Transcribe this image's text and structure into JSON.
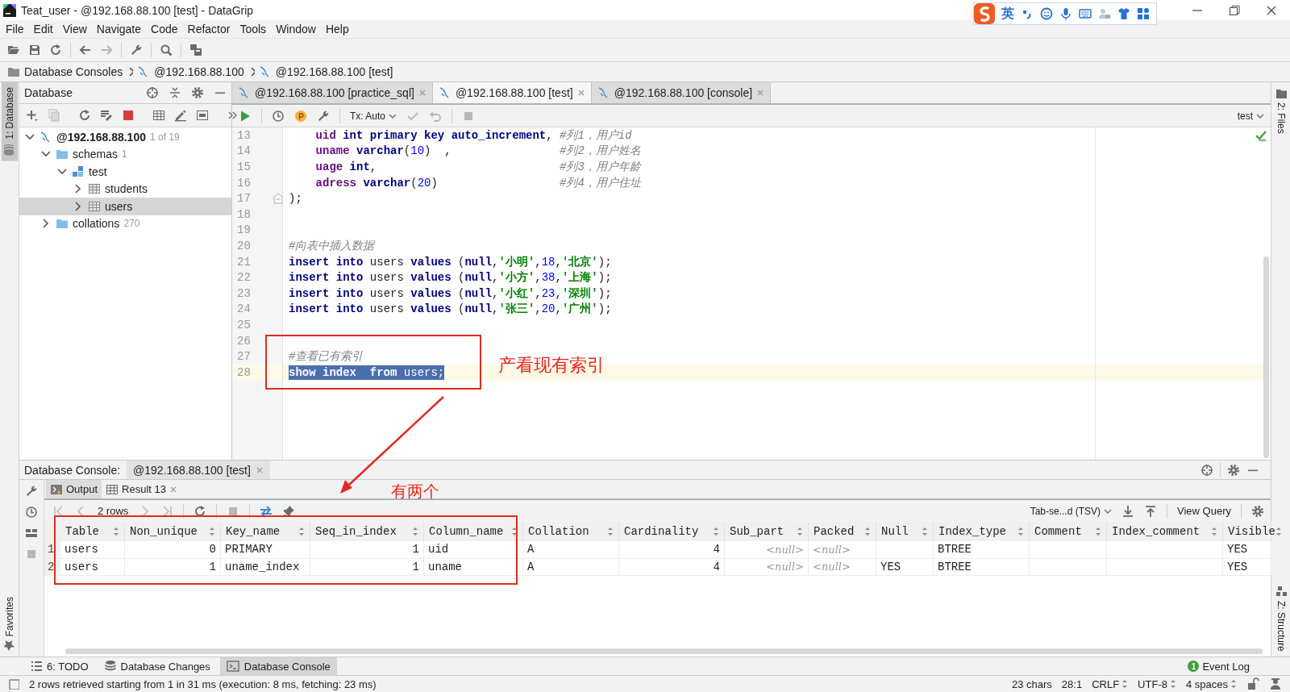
{
  "window": {
    "title": "Teat_user - @192.168.88.100 [test] - DataGrip"
  },
  "ime_toolbar": {
    "label": "英"
  },
  "menu": [
    "File",
    "Edit",
    "View",
    "Navigate",
    "Code",
    "Refactor",
    "Tools",
    "Window",
    "Help"
  ],
  "breadcrumbs": [
    "Database Consoles",
    "@192.168.88.100",
    "@192.168.88.100 [test]"
  ],
  "left_strip": {
    "top": "1: Database",
    "bottom": "Favorites"
  },
  "right_strip": {
    "top": "2: Files",
    "bottom": "Z: Structure"
  },
  "database_panel": {
    "title": "Database",
    "tree": [
      {
        "label": "@192.168.88.100",
        "badge": "1 of 19",
        "kind": "host",
        "expanded": true,
        "selected": false,
        "children": [
          {
            "label": "schemas",
            "badge": "1",
            "kind": "folder",
            "expanded": true,
            "selected": false,
            "children": [
              {
                "label": "test",
                "kind": "schema",
                "expanded": true,
                "selected": false,
                "children": [
                  {
                    "label": "students",
                    "kind": "table",
                    "expanded": false,
                    "selected": false
                  },
                  {
                    "label": "users",
                    "kind": "table",
                    "expanded": false,
                    "selected": true
                  }
                ]
              }
            ]
          },
          {
            "label": "collations",
            "badge": "270",
            "kind": "folder",
            "expanded": false,
            "selected": false
          }
        ]
      }
    ]
  },
  "editor": {
    "tabs": [
      {
        "label": "@192.168.88.100 [practice_sql]",
        "selected": false
      },
      {
        "label": "@192.168.88.100 [test]",
        "selected": true
      },
      {
        "label": "@192.168.88.100 [console]",
        "selected": false
      }
    ],
    "tx_mode": "Tx: Auto",
    "schema": "test",
    "lines": [
      {
        "no": "13",
        "current": false,
        "selected": false,
        "fold": false,
        "tokens": [
          {
            "kind": "col",
            "text": "    uid"
          },
          {
            "kind": "kw",
            "text": " int primary key auto_increment"
          },
          {
            "kind": "plain",
            "text": ","
          },
          {
            "kind": "trail",
            "text": "#列1，用户id"
          }
        ]
      },
      {
        "no": "14",
        "current": false,
        "selected": false,
        "fold": false,
        "tokens": [
          {
            "kind": "col",
            "text": "    uname"
          },
          {
            "kind": "kw",
            "text": " varchar"
          },
          {
            "kind": "plain",
            "text": "("
          },
          {
            "kind": "num",
            "text": "10"
          },
          {
            "kind": "plain",
            "text": ")  ,"
          },
          {
            "kind": "trail",
            "text": "#列2，用户姓名"
          }
        ]
      },
      {
        "no": "15",
        "current": false,
        "selected": false,
        "fold": false,
        "tokens": [
          {
            "kind": "col",
            "text": "    uage"
          },
          {
            "kind": "kw",
            "text": " int"
          },
          {
            "kind": "plain",
            "text": ","
          },
          {
            "kind": "trail",
            "text": "#列3，用户年龄"
          }
        ]
      },
      {
        "no": "16",
        "current": false,
        "selected": false,
        "fold": false,
        "tokens": [
          {
            "kind": "col",
            "text": "    adress"
          },
          {
            "kind": "kw",
            "text": " varchar"
          },
          {
            "kind": "plain",
            "text": "("
          },
          {
            "kind": "num",
            "text": "20"
          },
          {
            "kind": "plain",
            "text": ")"
          },
          {
            "kind": "trail",
            "text": "#列4，用户住址"
          }
        ]
      },
      {
        "no": "17",
        "current": false,
        "selected": false,
        "fold": true,
        "tokens": [
          {
            "kind": "plain",
            "text": ");"
          }
        ]
      },
      {
        "no": "18",
        "current": false,
        "selected": false,
        "fold": false
      },
      {
        "no": "19",
        "current": false,
        "selected": false,
        "fold": false
      },
      {
        "no": "20",
        "current": false,
        "selected": false,
        "fold": false,
        "tokens": [
          {
            "kind": "cm",
            "text": "#向表中插入数据"
          }
        ]
      },
      {
        "no": "21",
        "current": false,
        "selected": false,
        "fold": false,
        "tokens": [
          {
            "kind": "kw",
            "text": "insert into"
          },
          {
            "kind": "plain",
            "text": " users "
          },
          {
            "kind": "kw",
            "text": "values"
          },
          {
            "kind": "plain",
            "text": " ("
          },
          {
            "kind": "kw",
            "text": "null"
          },
          {
            "kind": "plain",
            "text": ","
          },
          {
            "kind": "str",
            "text": "'小明'"
          },
          {
            "kind": "plain",
            "text": ","
          },
          {
            "kind": "num",
            "text": "18"
          },
          {
            "kind": "plain",
            "text": ","
          },
          {
            "kind": "str",
            "text": "'北京'"
          },
          {
            "kind": "plain",
            "text": ");"
          }
        ]
      },
      {
        "no": "22",
        "current": false,
        "selected": false,
        "fold": false,
        "tokens": [
          {
            "kind": "kw",
            "text": "insert into"
          },
          {
            "kind": "plain",
            "text": " users "
          },
          {
            "kind": "kw",
            "text": "values"
          },
          {
            "kind": "plain",
            "text": " ("
          },
          {
            "kind": "kw",
            "text": "null"
          },
          {
            "kind": "plain",
            "text": ","
          },
          {
            "kind": "str",
            "text": "'小方'"
          },
          {
            "kind": "plain",
            "text": ","
          },
          {
            "kind": "num",
            "text": "38"
          },
          {
            "kind": "plain",
            "text": ","
          },
          {
            "kind": "str",
            "text": "'上海'"
          },
          {
            "kind": "plain",
            "text": ");"
          }
        ]
      },
      {
        "no": "23",
        "current": false,
        "selected": false,
        "fold": false,
        "tokens": [
          {
            "kind": "kw",
            "text": "insert into"
          },
          {
            "kind": "plain",
            "text": " users "
          },
          {
            "kind": "kw",
            "text": "values"
          },
          {
            "kind": "plain",
            "text": " ("
          },
          {
            "kind": "kw",
            "text": "null"
          },
          {
            "kind": "plain",
            "text": ","
          },
          {
            "kind": "str",
            "text": "'小红'"
          },
          {
            "kind": "plain",
            "text": ","
          },
          {
            "kind": "num",
            "text": "23"
          },
          {
            "kind": "plain",
            "text": ","
          },
          {
            "kind": "str",
            "text": "'深圳'"
          },
          {
            "kind": "plain",
            "text": ");"
          }
        ]
      },
      {
        "no": "24",
        "current": false,
        "selected": false,
        "fold": false,
        "tokens": [
          {
            "kind": "kw",
            "text": "insert into"
          },
          {
            "kind": "plain",
            "text": " users "
          },
          {
            "kind": "kw",
            "text": "values"
          },
          {
            "kind": "plain",
            "text": " ("
          },
          {
            "kind": "kw",
            "text": "null"
          },
          {
            "kind": "plain",
            "text": ","
          },
          {
            "kind": "str",
            "text": "'张三'"
          },
          {
            "kind": "plain",
            "text": ","
          },
          {
            "kind": "num",
            "text": "20"
          },
          {
            "kind": "plain",
            "text": ","
          },
          {
            "kind": "str",
            "text": "'广州'"
          },
          {
            "kind": "plain",
            "text": ");"
          }
        ]
      },
      {
        "no": "25",
        "current": false,
        "selected": false,
        "fold": false
      },
      {
        "no": "26",
        "current": false,
        "selected": false,
        "fold": false
      },
      {
        "no": "27",
        "current": false,
        "selected": false,
        "fold": false,
        "tokens": [
          {
            "kind": "cm",
            "text": "#查看已有索引"
          }
        ]
      },
      {
        "no": "28",
        "current": true,
        "selected": true,
        "fold": false,
        "tokens": [
          {
            "kind": "kw",
            "text": "show index  from"
          },
          {
            "kind": "plain",
            "text": " users;"
          }
        ]
      }
    ]
  },
  "console": {
    "title": "Database Console:",
    "tab": "@192.168.88.100 [test]",
    "result_tabs": [
      {
        "label": "Output",
        "selected": false
      },
      {
        "label": "Result 13",
        "selected": true
      }
    ],
    "row_count": "2 rows",
    "export_format": "Tab-se...d (TSV)",
    "view_query": "View Query",
    "table": {
      "columns": [
        {
          "label": "Table",
          "kind": "text"
        },
        {
          "label": "Non_unique",
          "kind": "number"
        },
        {
          "label": "Key_name",
          "kind": "text"
        },
        {
          "label": "Seq_in_index",
          "kind": "number"
        },
        {
          "label": "Column_name",
          "kind": "text"
        },
        {
          "label": "Collation",
          "kind": "text"
        },
        {
          "label": "Cardinality",
          "kind": "number"
        },
        {
          "label": "Sub_part",
          "kind": "number"
        },
        {
          "label": "Packed",
          "kind": "text"
        },
        {
          "label": "Null",
          "kind": "text"
        },
        {
          "label": "Index_type",
          "kind": "text"
        },
        {
          "label": "Comment",
          "kind": "text"
        },
        {
          "label": "Index_comment",
          "kind": "text"
        },
        {
          "label": "Visible",
          "kind": "text"
        }
      ],
      "rows": [
        {
          "no": "1",
          "cells": [
            {
              "kind": "value",
              "text": "users"
            },
            {
              "kind": "value",
              "text": "0"
            },
            {
              "kind": "value",
              "text": "PRIMARY"
            },
            {
              "kind": "value",
              "text": "1"
            },
            {
              "kind": "value",
              "text": "uid"
            },
            {
              "kind": "value",
              "text": "A"
            },
            {
              "kind": "value",
              "text": "4"
            },
            {
              "kind": "null",
              "text": "<null>"
            },
            {
              "kind": "null",
              "text": "<null>"
            },
            {
              "kind": "empty"
            },
            {
              "kind": "value",
              "text": "BTREE"
            },
            {
              "kind": "empty"
            },
            {
              "kind": "empty"
            },
            {
              "kind": "value",
              "text": "YES"
            }
          ]
        },
        {
          "no": "2",
          "cells": [
            {
              "kind": "value",
              "text": "users"
            },
            {
              "kind": "value",
              "text": "1"
            },
            {
              "kind": "value",
              "text": "uname_index"
            },
            {
              "kind": "value",
              "text": "1"
            },
            {
              "kind": "value",
              "text": "uname"
            },
            {
              "kind": "value",
              "text": "A"
            },
            {
              "kind": "value",
              "text": "4"
            },
            {
              "kind": "null",
              "text": "<null>"
            },
            {
              "kind": "null",
              "text": "<null>"
            },
            {
              "kind": "value",
              "text": "YES"
            },
            {
              "kind": "value",
              "text": "BTREE"
            },
            {
              "kind": "empty"
            },
            {
              "kind": "empty"
            },
            {
              "kind": "value",
              "text": "YES"
            }
          ]
        }
      ]
    }
  },
  "bottom_tabs": [
    {
      "label": "6: TODO",
      "selected": false
    },
    {
      "label": "Database Changes",
      "selected": false
    },
    {
      "label": "Database Console",
      "selected": true
    }
  ],
  "event_log": {
    "label": "Event Log",
    "count": "1"
  },
  "status_bar": {
    "message": "2 rows retrieved starting from 1 in 31 ms (execution: 8 ms, fetching: 23 ms)",
    "chars": "23 chars",
    "position": "28:1",
    "line_separator": "CRLF",
    "encoding": "UTF-8",
    "indent": "4 spaces"
  },
  "annotations": [
    {
      "text": "产看现有索引"
    },
    {
      "text": "有两个"
    }
  ]
}
